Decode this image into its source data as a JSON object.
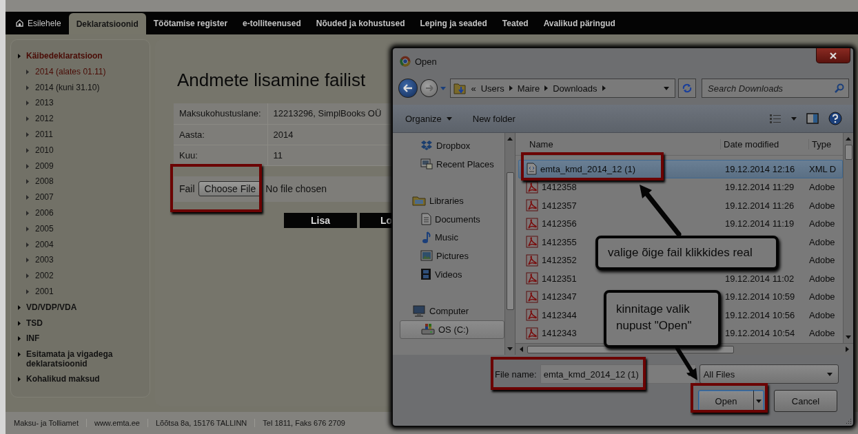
{
  "nav": {
    "tabs": [
      {
        "label": "Esilehele",
        "kind": "home",
        "selected": false
      },
      {
        "label": "Deklaratsioonid",
        "kind": "plain",
        "selected": true
      },
      {
        "label": "Töötamise register",
        "kind": "plain",
        "selected": false
      },
      {
        "label": "e-tolliteenused",
        "kind": "plain",
        "selected": false
      },
      {
        "label": "Nõuded ja kohustused",
        "kind": "plain",
        "selected": false
      },
      {
        "label": "Leping ja seaded",
        "kind": "plain",
        "selected": false
      },
      {
        "label": "Teated",
        "kind": "plain",
        "selected": false
      },
      {
        "label": "Avalikud päringud",
        "kind": "plain",
        "selected": false
      }
    ]
  },
  "sidebar": {
    "items": [
      {
        "label": "Käibedeklaratsioon",
        "selected": true,
        "children": [
          {
            "label": "2014 (alates 01.11)",
            "selected": true
          },
          {
            "label": "2014 (kuni 31.10)",
            "selected": false
          },
          {
            "label": "2013",
            "selected": false
          },
          {
            "label": "2012",
            "selected": false
          },
          {
            "label": "2011",
            "selected": false
          },
          {
            "label": "2010",
            "selected": false
          },
          {
            "label": "2009",
            "selected": false
          },
          {
            "label": "2008",
            "selected": false
          },
          {
            "label": "2007",
            "selected": false
          },
          {
            "label": "2006",
            "selected": false
          },
          {
            "label": "2005",
            "selected": false
          },
          {
            "label": "2004",
            "selected": false
          },
          {
            "label": "2003",
            "selected": false
          },
          {
            "label": "2002",
            "selected": false
          },
          {
            "label": "2001",
            "selected": false
          }
        ]
      },
      {
        "label": "VD/VDP/VDA",
        "selected": false
      },
      {
        "label": "TSD",
        "selected": false
      },
      {
        "label": "INF",
        "selected": false
      },
      {
        "label": "Esitamata ja vigadega deklaratsioonid",
        "selected": false
      },
      {
        "label": "Kohalikud maksud",
        "selected": false
      }
    ]
  },
  "main": {
    "title": "Andmete lisamine failist",
    "details": [
      {
        "label": "Maksukohustuslane:",
        "value": "12213296, SimplBooks OÜ"
      },
      {
        "label": "Aasta:",
        "value": "2014"
      },
      {
        "label": "Kuu:",
        "value": "11"
      }
    ],
    "file": {
      "label": "Fail",
      "button": "Choose File",
      "status": "No file chosen"
    },
    "buttons": [
      "Lisa",
      "Lo"
    ]
  },
  "footer": [
    "Maksu- ja Tolliamet",
    "www.emta.ee",
    "Lõõtsa 8a, 15176 TALLINN",
    "Tel 1811, Faks 676 2709"
  ],
  "dialog": {
    "title": "Open",
    "address": {
      "prefix": "«",
      "segments": [
        "Users",
        "Maire",
        "Downloads"
      ]
    },
    "search": {
      "placeholder": "Search Downloads"
    },
    "toolbar": [
      {
        "label": "Organize",
        "kind": "menu"
      },
      {
        "label": "New folder",
        "kind": "button"
      }
    ],
    "nav": [
      {
        "children": [
          {
            "label": "Dropbox",
            "kind": "dropbox",
            "selected": false
          },
          {
            "label": "Recent Places",
            "kind": "recent",
            "selected": false
          }
        ]
      },
      {
        "label": "Libraries",
        "kind": "library",
        "selected": false,
        "children": [
          {
            "label": "Documents",
            "kind": "documents",
            "selected": false
          },
          {
            "label": "Music",
            "kind": "music",
            "selected": false
          },
          {
            "label": "Pictures",
            "kind": "pictures",
            "selected": false
          },
          {
            "label": "Videos",
            "kind": "videos",
            "selected": false
          }
        ]
      },
      {
        "label": "Computer",
        "kind": "computer",
        "selected": false,
        "children": [
          {
            "label": "OS (C:)",
            "kind": "drive",
            "selected": true
          }
        ]
      }
    ],
    "columns": [
      "Name",
      "Date modified",
      "Type"
    ],
    "files": [
      {
        "name": "emta_kmd_2014_12 (1)",
        "date": "19.12.2014 12:16",
        "type": "XML D",
        "kind": "xml",
        "selected": true
      },
      {
        "name": "1412358",
        "date": "19.12.2014 11:29",
        "type": "Adobe",
        "kind": "pdf",
        "selected": false
      },
      {
        "name": "1412357",
        "date": "19.12.2014 11:26",
        "type": "Adobe",
        "kind": "pdf",
        "selected": false
      },
      {
        "name": "1412356",
        "date": "19.12.2014 11:19",
        "type": "Adobe",
        "kind": "pdf",
        "selected": false
      },
      {
        "name": "1412355",
        "type": "Adobe",
        "kind": "pdf",
        "selected": false
      },
      {
        "name": "1412352",
        "type": "Adobe",
        "kind": "pdf",
        "selected": false
      },
      {
        "name": "1412351",
        "date": "19.12.2014 11:02",
        "type": "Adobe",
        "kind": "pdf",
        "selected": false
      },
      {
        "name": "1412347",
        "date": "19.12.2014 10:59",
        "type": "Adobe",
        "kind": "pdf",
        "selected": false
      },
      {
        "name": "1412344",
        "date": "19.12.2014 10:56",
        "type": "Adobe",
        "kind": "pdf",
        "selected": false
      },
      {
        "name": "1412343",
        "date": "19.12.2014 10:54",
        "type": "Adobe",
        "kind": "pdf",
        "selected": false
      }
    ],
    "file_name": {
      "label": "File name:",
      "value": "emta_kmd_2014_12 (1)"
    },
    "filter": "All Files",
    "buttons": [
      {
        "label": "Open",
        "kind": "split"
      },
      {
        "label": "Cancel",
        "kind": "plain"
      }
    ]
  },
  "annotations": {
    "callouts": [
      "valige õige fail klikkides real",
      "kinnitage valik nupust \"Open\""
    ]
  }
}
